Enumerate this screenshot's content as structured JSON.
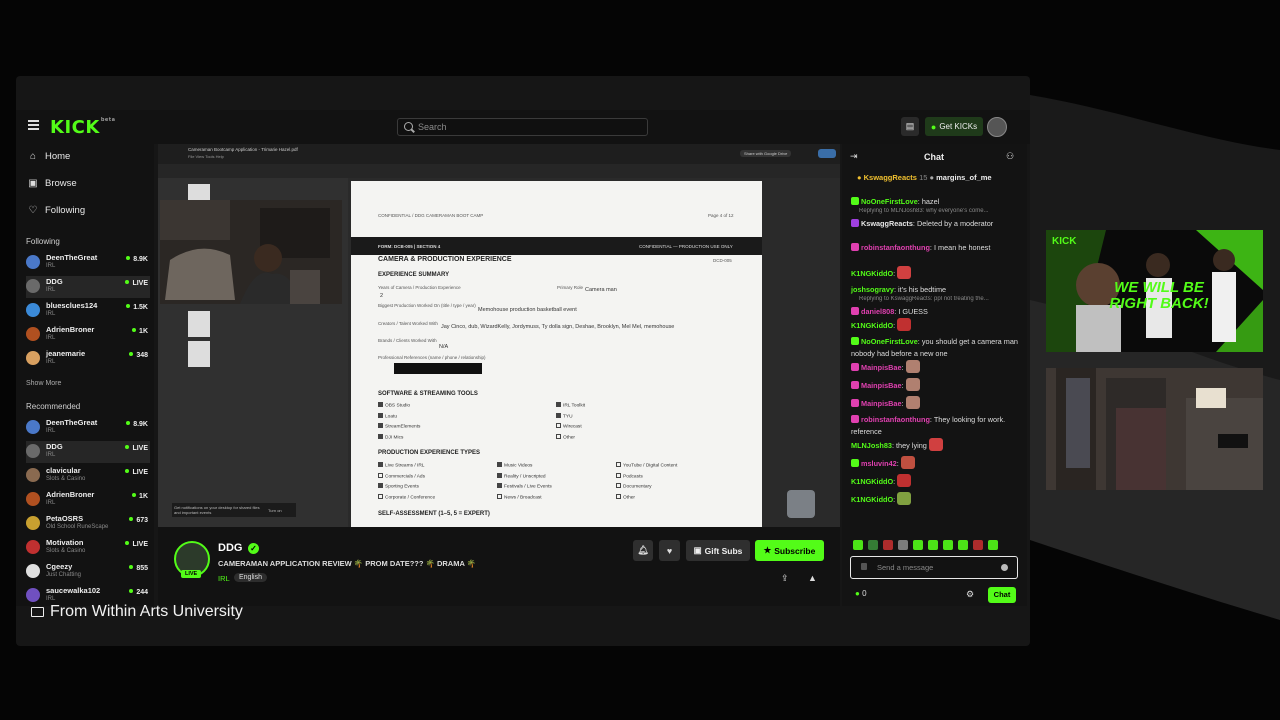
{
  "app": {
    "logo": "KICK",
    "logo_sup": "beta"
  },
  "caption": {
    "text": "From Within Arts University"
  },
  "header": {
    "search_placeholder": "Search",
    "get_kicks_label": "Get KICKs"
  },
  "nav": {
    "home": "Home",
    "browse": "Browse",
    "following": "Following"
  },
  "following": {
    "heading": "Following",
    "show_more": "Show More",
    "channels": [
      {
        "name": "DeenTheGreat",
        "category": "IRL",
        "viewers": "8.9K",
        "color": "#4a78c8"
      },
      {
        "name": "DDG",
        "category": "IRL",
        "viewers": "LIVE",
        "color": "#6a6a6a"
      },
      {
        "name": "bluesclues124",
        "category": "IRL",
        "viewers": "1.5K",
        "color": "#3b8ad8"
      },
      {
        "name": "AdrienBroner",
        "category": "IRL",
        "viewers": "1K",
        "color": "#b05020"
      },
      {
        "name": "jeanemarie",
        "category": "IRL",
        "viewers": "348",
        "color": "#d8a060"
      }
    ]
  },
  "recommended": {
    "heading": "Recommended",
    "channels": [
      {
        "name": "DeenTheGreat",
        "category": "IRL",
        "viewers": "8.9K",
        "color": "#4a78c8"
      },
      {
        "name": "DDG",
        "category": "IRL",
        "viewers": "LIVE",
        "color": "#6a6a6a"
      },
      {
        "name": "clavicular",
        "category": "Slots & Casino",
        "viewers": "LIVE",
        "color": "#8a6a50"
      },
      {
        "name": "AdrienBroner",
        "category": "IRL",
        "viewers": "1K",
        "color": "#b05020"
      },
      {
        "name": "PetaOSRS",
        "category": "Old School RuneScape",
        "viewers": "673",
        "color": "#c8a030"
      },
      {
        "name": "Motivation",
        "category": "Slots & Casino",
        "viewers": "LIVE",
        "color": "#c03030"
      },
      {
        "name": "Cgeezy",
        "category": "Just Chatting",
        "viewers": "855",
        "color": "#e0e0e0"
      },
      {
        "name": "saucewalka102",
        "category": "IRL",
        "viewers": "244",
        "color": "#7050c0"
      }
    ]
  },
  "pdf": {
    "filename": "Cameraman Bootcamp Application - Trimarie Hazel.pdf",
    "menu": "File  View  Tools  Help",
    "share": "Share with Google Drive",
    "page_info": "Page 4 of 12",
    "conf_header": "CONFIDENTIAL / DDG CAMERAMAN BOOT CAMP",
    "form_line": "FORM: DCB-005  |  SECTION 4",
    "conf_right": "CONFIDENTIAL — PRODUCTION USE ONLY",
    "section_title": "CAMERA & PRODUCTION EXPERIENCE",
    "section_code": "DCD-005",
    "exp_summary": "EXPERIENCE SUMMARY",
    "years_label": "Years of Camera / Production Experience",
    "years_value": "2",
    "primary_label": "Primary Role",
    "primary_value": "Camera man",
    "biggest_label": "Biggest Production Worked On (title / type / year)",
    "biggest_value": "Memohouse production basketball event",
    "creators_label": "Creators / Talent Worked With",
    "creators_value": "Jay Cinco, dub, WizardKelly, Jordymuss, Ty dolla sign, Deshae, Brooklyn, Mel Mel, memohouse",
    "brands_label": "Brands / Clients Worked With",
    "brands_value": "N/A",
    "refs_label": "Professional References (name / phone / relationship)",
    "software_title": "SOFTWARE & STREAMING TOOLS",
    "software": [
      "OBS Studio",
      "Loatu",
      "StreamElements",
      "DJI Mics",
      "IRL Toolkit",
      "TYU",
      "Wirecast",
      "Other"
    ],
    "production_title": "PRODUCTION EXPERIENCE TYPES",
    "production": [
      "Live Streams / IRL",
      "Commercials / Ads",
      "Sporting Events",
      "Corporate / Conference",
      "Music Videos",
      "Reality / Unscripted",
      "Festivals / Live Events",
      "News / Broadcast",
      "YouTube / Digital Content",
      "Podcasts",
      "Documentary",
      "Other"
    ],
    "self_title": "SELF-ASSESSMENT (1–5, 5 = EXPERT)",
    "notif": "Get notifications on your desktop for shared files and important events",
    "notif_btn": "Turn on"
  },
  "stream": {
    "streamer": "DDG",
    "live_badge": "LIVE",
    "title": "CAMERAMAN APPLICATION REVIEW 🌴 PROM DATE??? 🌴 DRAMA 🌴",
    "category": "IRL",
    "tag": "English",
    "gift_subs": "Gift Subs",
    "subscribe": "Subscribe"
  },
  "chat": {
    "title": "Chat",
    "pinned_user1": "KswaggReacts",
    "pinned_count": "15",
    "pinned_user2": "margins_of_me",
    "messages": [
      {
        "type": "msg",
        "user": "NoOneFirstLove",
        "color": "#53fc18",
        "text": ": hazel",
        "badge": "#53fc18"
      },
      {
        "type": "reply",
        "text": "Replying to MLNJosh83: why everyone's come..."
      },
      {
        "type": "msg",
        "user": "KswaggReacts",
        "color": "#e8e8e8",
        "text": ": Deleted by a moderator",
        "badge": "#a040e0"
      },
      {
        "type": "msg",
        "user": "robinstanfaonthung",
        "color": "#e040b0",
        "text": ": I mean he honest",
        "badge": "#e040b0"
      },
      {
        "type": "msg",
        "user": "K1NGKiddO",
        "color": "#53fc18",
        "text": ":",
        "emote": "#d04040"
      },
      {
        "type": "msg",
        "user": "joshsogravy",
        "color": "#53fc18",
        "text": ": it's his bedtime"
      },
      {
        "type": "reply",
        "text": "Replying to KswaggReacts: ppl not treating the..."
      },
      {
        "type": "msg",
        "user": "daniel808",
        "color": "#e040b0",
        "text": ": I GUESS",
        "badge": "#e040b0"
      },
      {
        "type": "msg",
        "user": "K1NGKiddO",
        "color": "#53fc18",
        "text": ":",
        "emote": "#c03030"
      },
      {
        "type": "msg",
        "user": "NoOneFirstLove",
        "color": "#53fc18",
        "text": ": you should get a camera man nobody had before a new one",
        "badge": "#53fc18"
      },
      {
        "type": "msg",
        "user": "MainpisBae",
        "color": "#e040b0",
        "text": ":",
        "emote": "#b08070",
        "badge": "#e040b0"
      },
      {
        "type": "msg",
        "user": "MainpisBae",
        "color": "#e040b0",
        "text": ":",
        "emote": "#b08070",
        "badge": "#e040b0"
      },
      {
        "type": "msg",
        "user": "MainpisBae",
        "color": "#e040b0",
        "text": ":",
        "emote": "#b08070",
        "badge": "#e040b0"
      },
      {
        "type": "msg",
        "user": "robinstanfaonthung",
        "color": "#e040b0",
        "text": ": They looking for work. reference",
        "badge": "#e040b0"
      },
      {
        "type": "msg",
        "user": "MLNJosh83",
        "color": "#53fc18",
        "text": ": they lying",
        "emote": "#d04040"
      },
      {
        "type": "msg",
        "user": "msluvin42",
        "color": "#e040b0",
        "text": ":",
        "emote": "#c05040",
        "badge": "#53fc18"
      },
      {
        "type": "msg",
        "user": "K1NGKiddO",
        "color": "#53fc18",
        "text": ":",
        "emote": "#c03030"
      },
      {
        "type": "msg",
        "user": "K1NGKiddO",
        "color": "#53fc18",
        "text": ":",
        "emote": "#80a040"
      }
    ],
    "input_placeholder": "Send a message",
    "kicks_count": "0",
    "send": "Chat"
  },
  "ad": {
    "brand": "KICK",
    "headline": "WE WILL BE RIGHT BACK!"
  }
}
